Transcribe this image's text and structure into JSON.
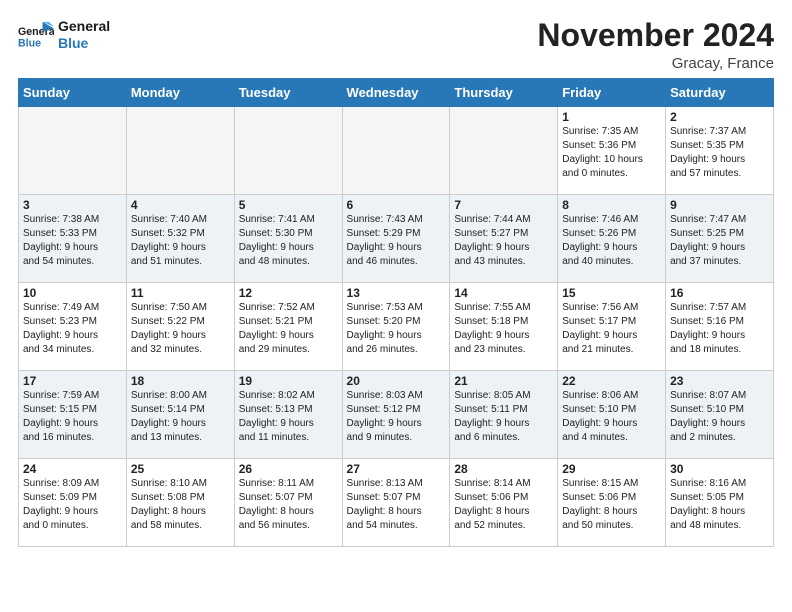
{
  "header": {
    "logo_line1": "General",
    "logo_line2": "Blue",
    "month": "November 2024",
    "location": "Gracay, France"
  },
  "weekdays": [
    "Sunday",
    "Monday",
    "Tuesday",
    "Wednesday",
    "Thursday",
    "Friday",
    "Saturday"
  ],
  "weeks": [
    [
      {
        "day": "",
        "info": ""
      },
      {
        "day": "",
        "info": ""
      },
      {
        "day": "",
        "info": ""
      },
      {
        "day": "",
        "info": ""
      },
      {
        "day": "",
        "info": ""
      },
      {
        "day": "1",
        "info": "Sunrise: 7:35 AM\nSunset: 5:36 PM\nDaylight: 10 hours\nand 0 minutes."
      },
      {
        "day": "2",
        "info": "Sunrise: 7:37 AM\nSunset: 5:35 PM\nDaylight: 9 hours\nand 57 minutes."
      }
    ],
    [
      {
        "day": "3",
        "info": "Sunrise: 7:38 AM\nSunset: 5:33 PM\nDaylight: 9 hours\nand 54 minutes."
      },
      {
        "day": "4",
        "info": "Sunrise: 7:40 AM\nSunset: 5:32 PM\nDaylight: 9 hours\nand 51 minutes."
      },
      {
        "day": "5",
        "info": "Sunrise: 7:41 AM\nSunset: 5:30 PM\nDaylight: 9 hours\nand 48 minutes."
      },
      {
        "day": "6",
        "info": "Sunrise: 7:43 AM\nSunset: 5:29 PM\nDaylight: 9 hours\nand 46 minutes."
      },
      {
        "day": "7",
        "info": "Sunrise: 7:44 AM\nSunset: 5:27 PM\nDaylight: 9 hours\nand 43 minutes."
      },
      {
        "day": "8",
        "info": "Sunrise: 7:46 AM\nSunset: 5:26 PM\nDaylight: 9 hours\nand 40 minutes."
      },
      {
        "day": "9",
        "info": "Sunrise: 7:47 AM\nSunset: 5:25 PM\nDaylight: 9 hours\nand 37 minutes."
      }
    ],
    [
      {
        "day": "10",
        "info": "Sunrise: 7:49 AM\nSunset: 5:23 PM\nDaylight: 9 hours\nand 34 minutes."
      },
      {
        "day": "11",
        "info": "Sunrise: 7:50 AM\nSunset: 5:22 PM\nDaylight: 9 hours\nand 32 minutes."
      },
      {
        "day": "12",
        "info": "Sunrise: 7:52 AM\nSunset: 5:21 PM\nDaylight: 9 hours\nand 29 minutes."
      },
      {
        "day": "13",
        "info": "Sunrise: 7:53 AM\nSunset: 5:20 PM\nDaylight: 9 hours\nand 26 minutes."
      },
      {
        "day": "14",
        "info": "Sunrise: 7:55 AM\nSunset: 5:18 PM\nDaylight: 9 hours\nand 23 minutes."
      },
      {
        "day": "15",
        "info": "Sunrise: 7:56 AM\nSunset: 5:17 PM\nDaylight: 9 hours\nand 21 minutes."
      },
      {
        "day": "16",
        "info": "Sunrise: 7:57 AM\nSunset: 5:16 PM\nDaylight: 9 hours\nand 18 minutes."
      }
    ],
    [
      {
        "day": "17",
        "info": "Sunrise: 7:59 AM\nSunset: 5:15 PM\nDaylight: 9 hours\nand 16 minutes."
      },
      {
        "day": "18",
        "info": "Sunrise: 8:00 AM\nSunset: 5:14 PM\nDaylight: 9 hours\nand 13 minutes."
      },
      {
        "day": "19",
        "info": "Sunrise: 8:02 AM\nSunset: 5:13 PM\nDaylight: 9 hours\nand 11 minutes."
      },
      {
        "day": "20",
        "info": "Sunrise: 8:03 AM\nSunset: 5:12 PM\nDaylight: 9 hours\nand 9 minutes."
      },
      {
        "day": "21",
        "info": "Sunrise: 8:05 AM\nSunset: 5:11 PM\nDaylight: 9 hours\nand 6 minutes."
      },
      {
        "day": "22",
        "info": "Sunrise: 8:06 AM\nSunset: 5:10 PM\nDaylight: 9 hours\nand 4 minutes."
      },
      {
        "day": "23",
        "info": "Sunrise: 8:07 AM\nSunset: 5:10 PM\nDaylight: 9 hours\nand 2 minutes."
      }
    ],
    [
      {
        "day": "24",
        "info": "Sunrise: 8:09 AM\nSunset: 5:09 PM\nDaylight: 9 hours\nand 0 minutes."
      },
      {
        "day": "25",
        "info": "Sunrise: 8:10 AM\nSunset: 5:08 PM\nDaylight: 8 hours\nand 58 minutes."
      },
      {
        "day": "26",
        "info": "Sunrise: 8:11 AM\nSunset: 5:07 PM\nDaylight: 8 hours\nand 56 minutes."
      },
      {
        "day": "27",
        "info": "Sunrise: 8:13 AM\nSunset: 5:07 PM\nDaylight: 8 hours\nand 54 minutes."
      },
      {
        "day": "28",
        "info": "Sunrise: 8:14 AM\nSunset: 5:06 PM\nDaylight: 8 hours\nand 52 minutes."
      },
      {
        "day": "29",
        "info": "Sunrise: 8:15 AM\nSunset: 5:06 PM\nDaylight: 8 hours\nand 50 minutes."
      },
      {
        "day": "30",
        "info": "Sunrise: 8:16 AM\nSunset: 5:05 PM\nDaylight: 8 hours\nand 48 minutes."
      }
    ]
  ]
}
